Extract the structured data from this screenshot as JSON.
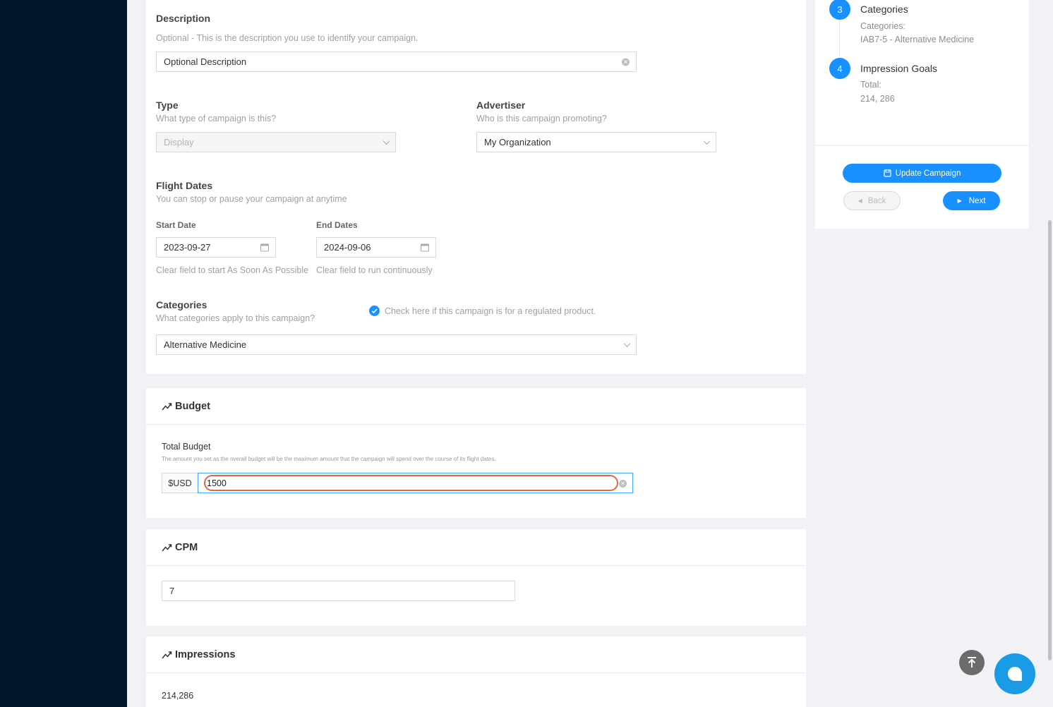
{
  "form": {
    "description": {
      "label": "Description",
      "hint": "Optional - This is the description you use to identify your campaign.",
      "value": "Optional Description"
    },
    "type": {
      "label": "Type",
      "hint": "What type of campaign is this?",
      "value": "Display"
    },
    "advertiser": {
      "label": "Advertiser",
      "hint": "Who is this campaign promoting?",
      "value": "My Organization"
    },
    "flight_dates": {
      "label": "Flight Dates",
      "hint": "You can stop or pause your campaign at anytime",
      "start_label": "Start Date",
      "start_value": "2023-09-27",
      "start_hint": "Clear field to start As Soon As Possible",
      "end_label": "End Dates",
      "end_value": "2024-09-06",
      "end_hint": "Clear field to run continuously"
    },
    "categories": {
      "label": "Categories",
      "hint": "What categories apply to this campaign?",
      "regulated_label": "Check here if this campaign is for a regulated product.",
      "value": "Alternative Medicine"
    }
  },
  "budget": {
    "title": "Budget",
    "total_label": "Total Budget",
    "total_hint": "The amount you set as the overall budget will be the maximum amount that the campaign will spend over the course of its flight dates.",
    "currency": "$USD",
    "value": "1500"
  },
  "cpm": {
    "title": "CPM",
    "value": "7"
  },
  "impressions": {
    "title": "Impressions",
    "value": "214,286"
  },
  "summary": {
    "steps": [
      {
        "number": "3",
        "title": "Categories",
        "sub_label": "Categories:",
        "sub_value": "IAB7-5 - Alternative Medicine"
      },
      {
        "number": "4",
        "title": "Impression Goals",
        "sub_label": "Total:",
        "sub_value": "214, 286"
      }
    ],
    "update_label": "Update Campaign",
    "back_label": "Back",
    "next_label": "Next"
  },
  "colors": {
    "sidebar": "#00152b",
    "primary": "#1890ff",
    "highlight": "#e8663d",
    "chat": "#1a9be6"
  }
}
